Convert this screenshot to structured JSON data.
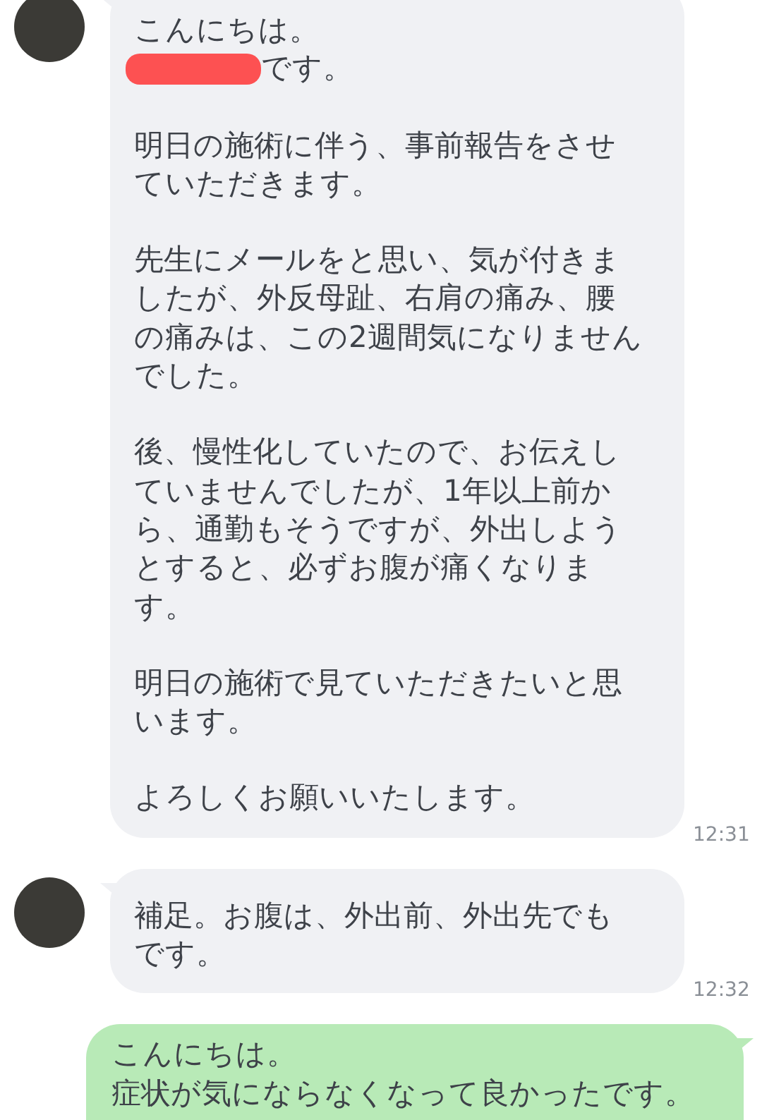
{
  "messages": [
    {
      "kind": "incoming",
      "time": "12:31",
      "paragraphs": [
        [
          {
            "text": "こんにちは。",
            "redacted": false
          },
          {
            "text": "です。",
            "redacted": true
          }
        ],
        [
          {
            "text": "明日の施術に伴う、事前報告をさせ",
            "redacted": false
          },
          {
            "text": "ていただきます。",
            "redacted": false
          }
        ],
        [
          {
            "text": "先生にメールをと思い、気が付きま",
            "redacted": false
          },
          {
            "text": "したが、外反母趾、右肩の痛み、腰",
            "redacted": false
          },
          {
            "text": "の痛みは、この2週間気になりません",
            "redacted": false
          },
          {
            "text": "でした。",
            "redacted": false
          }
        ],
        [
          {
            "text": "後、慢性化していたので、お伝えし",
            "redacted": false
          },
          {
            "text": "ていませんでしたが、1年以上前か",
            "redacted": false
          },
          {
            "text": "ら、通勤もそうですが、外出しよう",
            "redacted": false
          },
          {
            "text": "とすると、必ずお腹が痛くなりま",
            "redacted": false
          },
          {
            "text": "す。",
            "redacted": false
          }
        ],
        [
          {
            "text": "明日の施術で見ていただきたいと思",
            "redacted": false
          },
          {
            "text": "います。",
            "redacted": false
          }
        ],
        [
          {
            "text": "よろしくお願いいたします。",
            "redacted": false
          }
        ]
      ]
    },
    {
      "kind": "incoming",
      "time": "12:32",
      "paragraphs": [
        [
          {
            "text": "補足。お腹は、外出前、外出先でも",
            "redacted": false
          },
          {
            "text": "です。",
            "redacted": false
          }
        ]
      ]
    },
    {
      "kind": "outgoing",
      "paragraphs": [
        [
          {
            "text": "こんにちは。",
            "redacted": false
          },
          {
            "text": "症状が気にならなくなって良かったです。",
            "redacted": false
          }
        ]
      ]
    }
  ]
}
